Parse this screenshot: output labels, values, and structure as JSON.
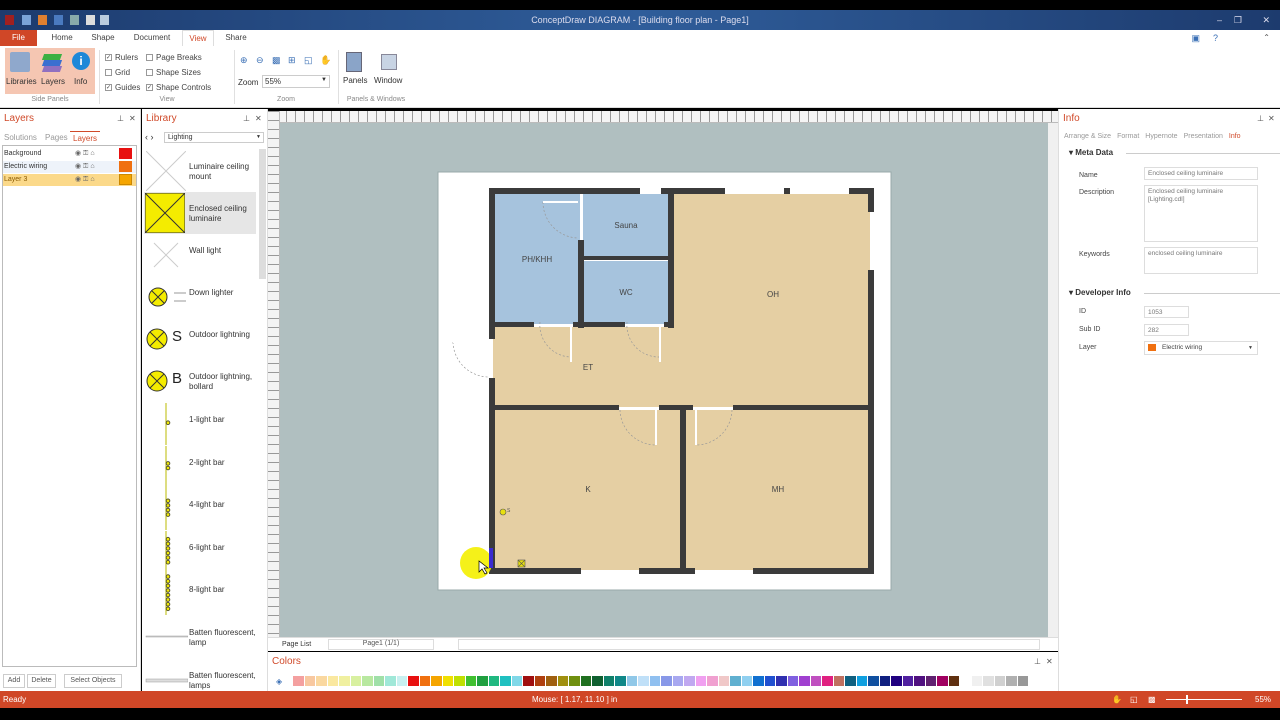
{
  "window": {
    "title": "ConceptDraw DIAGRAM - [Building floor plan - Page1]"
  },
  "tabs": [
    "File",
    "Home",
    "Shape",
    "Document",
    "View",
    "Share"
  ],
  "ribbon": {
    "side_panels": {
      "label": "Side Panels",
      "buttons": [
        "Libraries",
        "Layers",
        "Info"
      ]
    },
    "view": {
      "label": "View",
      "checks": [
        {
          "label": "Rulers",
          "checked": true
        },
        {
          "label": "Grid",
          "checked": false
        },
        {
          "label": "Guides",
          "checked": true
        },
        {
          "label": "Page Breaks",
          "checked": false
        },
        {
          "label": "Shape Sizes",
          "checked": false
        },
        {
          "label": "Shape Controls",
          "checked": true
        }
      ]
    },
    "zoom": {
      "label": "Zoom",
      "zoom_label": "Zoom",
      "value": "55%"
    },
    "panels_windows": {
      "label": "Panels & Windows",
      "buttons": [
        "Panels",
        "Window"
      ]
    }
  },
  "layers_panel": {
    "title": "Layers",
    "tabs": [
      "Solutions",
      "Pages",
      "Layers"
    ],
    "layers": [
      {
        "name": "Background",
        "color": "#e81010"
      },
      {
        "name": "Electric wiring",
        "color": "#f07010"
      },
      {
        "name": "Layer 3",
        "color": "#f5a500"
      }
    ],
    "buttons": [
      "Add",
      "Delete",
      "Select Objects"
    ]
  },
  "library_panel": {
    "title": "Library",
    "selected": "Lighting",
    "items": [
      "Luminaire ceiling mount",
      "Enclosed ceiling luminaire",
      "Wall light",
      "Down lighter",
      "Outdoor lightning",
      "Outdoor lightning, bollard",
      "1-light bar",
      "2-light bar",
      "4-light bar",
      "6-light bar",
      "8-light bar",
      "Batten fluorescent, lamp",
      "Batten fluorescent, lamps"
    ],
    "icon_letters": {
      "outdoor": "S",
      "bollard": "B"
    }
  },
  "floor_plan": {
    "rooms": [
      "PH/KHH",
      "Sauna",
      "WC",
      "OH",
      "ET",
      "K",
      "MH"
    ],
    "fixture_label": "S"
  },
  "page_list": {
    "label": "Page List",
    "page": "Page1 (1/1)"
  },
  "colors_panel": {
    "title": "Colors",
    "swatches": [
      "#f4a0a0",
      "#f8c8a0",
      "#fad8a0",
      "#fae8a0",
      "#f0f0a0",
      "#d8f0a0",
      "#b8e8a0",
      "#a0e0a8",
      "#a0e8d8",
      "#c8f0f0",
      "#e81010",
      "#f07010",
      "#f5a500",
      "#f0e000",
      "#c0e000",
      "#40c030",
      "#20a040",
      "#20b880",
      "#20c0c0",
      "#80d8e8",
      "#a01010",
      "#b04010",
      "#a06010",
      "#a09010",
      "#709010",
      "#207020",
      "#106030",
      "#10806a",
      "#108888",
      "#90c8e8",
      "#c0e0f8",
      "#90c0f0",
      "#8898e8",
      "#a8a8f0",
      "#c0a8f0",
      "#f0a0f0",
      "#f0a0d0",
      "#f0c8c8",
      "#60b0d0",
      "#90d0f0",
      "#1070d0",
      "#2050d0",
      "#3030b0",
      "#8060e0",
      "#a040d0",
      "#c050c0",
      "#e02080",
      "#c07060",
      "#106080",
      "#10a0e0",
      "#1050a0",
      "#102080",
      "#200080",
      "#5020a0",
      "#501080",
      "#602070",
      "#a00060",
      "#603010",
      "#ffffff",
      "#f0f0f0",
      "#e0e0e0",
      "#d0d0d0",
      "#b0b0b0",
      "#989898"
    ]
  },
  "info_panel": {
    "title": "Info",
    "tabs": [
      "Arrange & Size",
      "Format",
      "Hypernote",
      "Presentation",
      "Info"
    ],
    "meta": {
      "title": "Meta Data",
      "name_label": "Name",
      "name": "Enclosed ceiling luminaire",
      "description_label": "Description",
      "description": "Enclosed ceiling luminaire [Lighting.cdl]",
      "keywords_label": "Keywords",
      "keywords": "enclosed ceiling luminaire"
    },
    "developer": {
      "title": "Developer Info",
      "id_label": "ID",
      "id": "1053",
      "subid_label": "Sub ID",
      "subid": "282",
      "layer_label": "Layer",
      "layer": "Electric wiring",
      "layer_color": "#f07010"
    }
  },
  "status": {
    "left": "Ready",
    "mouse": "Mouse: [ 1.17, 11.10 ] in",
    "zoom": "55%"
  }
}
